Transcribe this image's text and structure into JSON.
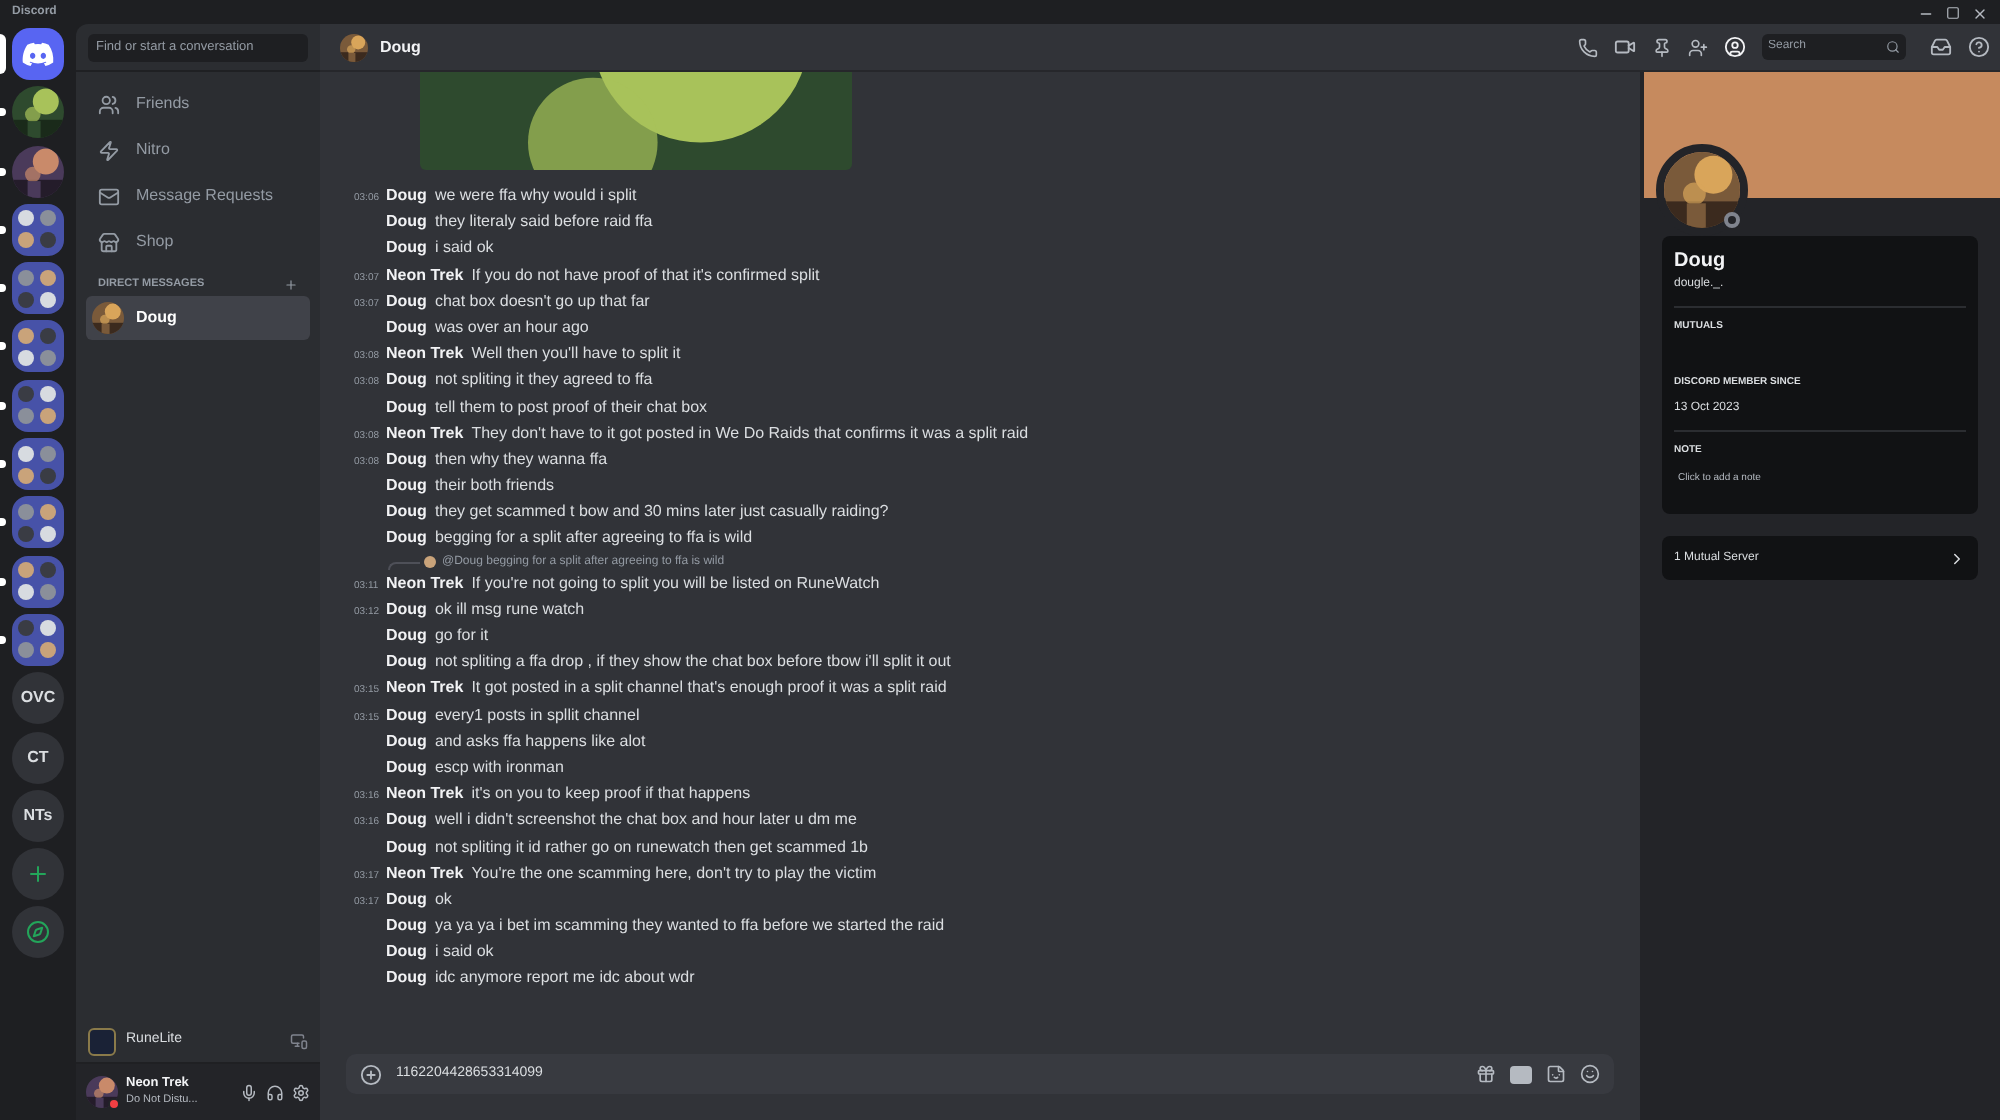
{
  "window": {
    "title": "Discord"
  },
  "servers": [
    {
      "kind": "home",
      "selected": true,
      "unread": false
    },
    {
      "kind": "picture",
      "selected": false,
      "unread": true
    },
    {
      "kind": "picture",
      "selected": false,
      "unread": true
    },
    {
      "kind": "folder",
      "selected": false,
      "unread": true
    },
    {
      "kind": "folder",
      "selected": false,
      "unread": true
    },
    {
      "kind": "folder",
      "selected": false,
      "unread": true
    },
    {
      "kind": "folder",
      "selected": false,
      "unread": true
    },
    {
      "kind": "folder",
      "selected": false,
      "unread": true
    },
    {
      "kind": "folder",
      "selected": false,
      "unread": true
    },
    {
      "kind": "folder",
      "selected": false,
      "unread": true
    },
    {
      "kind": "folder",
      "selected": false,
      "unread": true
    },
    {
      "kind": "text",
      "label": "OVC",
      "selected": false,
      "unread": false
    },
    {
      "kind": "text",
      "label": "CT",
      "selected": false,
      "unread": false
    },
    {
      "kind": "text",
      "label": "NTs",
      "selected": false,
      "unread": false
    },
    {
      "kind": "add"
    },
    {
      "kind": "explore"
    }
  ],
  "sidebar": {
    "search": {
      "placeholder": "Find or start a conversation"
    },
    "nav": [
      {
        "kind": "friends",
        "label": "Friends"
      },
      {
        "kind": "nitro",
        "label": "Nitro"
      },
      {
        "kind": "requests",
        "label": "Message Requests"
      },
      {
        "kind": "shop",
        "label": "Shop"
      }
    ],
    "dm_header": "DIRECT MESSAGES",
    "dms": [
      {
        "name": "Doug",
        "selected": true
      }
    ],
    "activity": {
      "name": "RuneLite"
    },
    "user": {
      "name": "Neon Trek",
      "status": "Do Not Distu..."
    }
  },
  "header": {
    "name": "Doug",
    "search": {
      "placeholder": "Search"
    }
  },
  "messages": [
    {
      "time": "03:06",
      "author": "Doug",
      "text": "we were ffa why would i split"
    },
    {
      "author": "Doug",
      "text": "they literaly said before raid ffa"
    },
    {
      "author": "Doug",
      "text": "i said ok"
    },
    {
      "time": "03:07",
      "author": "Neon Trek",
      "text": "If you do not have proof of that it's confirmed split"
    },
    {
      "time": "03:07",
      "author": "Doug",
      "text": "chat box doesn't go up that far"
    },
    {
      "author": "Doug",
      "text": "was over an hour ago"
    },
    {
      "time": "03:08",
      "author": "Neon Trek",
      "text": "Well then you'll have to split it"
    },
    {
      "time": "03:08",
      "author": "Doug",
      "text": "not spliting it they agreed to ffa"
    },
    {
      "author": "Doug",
      "text": "tell them to post proof of their chat box"
    },
    {
      "time": "03:08",
      "author": "Neon Trek",
      "text": "They don't have to it got posted in We Do Raids that confirms it was a split raid"
    },
    {
      "time": "03:08",
      "author": "Doug",
      "text": "then why they wanna ffa"
    },
    {
      "author": "Doug",
      "text": "their both friends"
    },
    {
      "author": "Doug",
      "text": "they get scammed t bow and 30 mins later just casually raiding?"
    },
    {
      "author": "Doug",
      "text": "begging for a split after agreeing to ffa is wild"
    },
    {
      "time": "03:11",
      "author": "Neon Trek",
      "text": "If you're not going to split you will be listed on RuneWatch",
      "reply": {
        "text": "@Doug begging for a split after agreeing to ffa is wild"
      }
    },
    {
      "time": "03:12",
      "author": "Doug",
      "text": "ok ill msg rune watch"
    },
    {
      "author": "Doug",
      "text": "go for it"
    },
    {
      "author": "Doug",
      "text": "not spliting a ffa drop , if they show the chat box before tbow i'll split it out"
    },
    {
      "time": "03:15",
      "author": "Neon Trek",
      "text": "It got posted in a split channel that's enough proof it was a split raid"
    },
    {
      "time": "03:15",
      "author": "Doug",
      "text": "every1 posts in spllit channel"
    },
    {
      "author": "Doug",
      "text": "and asks ffa happens like alot"
    },
    {
      "author": "Doug",
      "text": "escp with ironman"
    },
    {
      "time": "03:16",
      "author": "Neon Trek",
      "text": "it's on you to keep proof if that happens"
    },
    {
      "time": "03:16",
      "author": "Doug",
      "text": "well i didn't screenshot the chat box and hour later u dm me"
    },
    {
      "author": "Doug",
      "text": "not spliting it id rather go on runewatch then get scammed 1b"
    },
    {
      "time": "03:17",
      "author": "Neon Trek",
      "text": "You're the one scamming here, don't try to play the victim"
    },
    {
      "time": "03:17",
      "author": "Doug",
      "text": "ok"
    },
    {
      "author": "Doug",
      "text": "ya ya ya i bet im scamming they wanted to ffa before we started the raid"
    },
    {
      "author": "Doug",
      "text": "i said ok"
    },
    {
      "author": "Doug",
      "text": "idc anymore report me idc about wdr"
    }
  ],
  "composer": {
    "value": "1162204428653314099"
  },
  "profile": {
    "name": "Doug",
    "username": "dougle._.",
    "mutuals_label": "MUTUALS",
    "member_since_label": "DISCORD MEMBER SINCE",
    "member_since": "13 Oct 2023",
    "note_label": "NOTE",
    "note_placeholder": "Click to add a note",
    "mutual_servers": "1 Mutual Server"
  }
}
